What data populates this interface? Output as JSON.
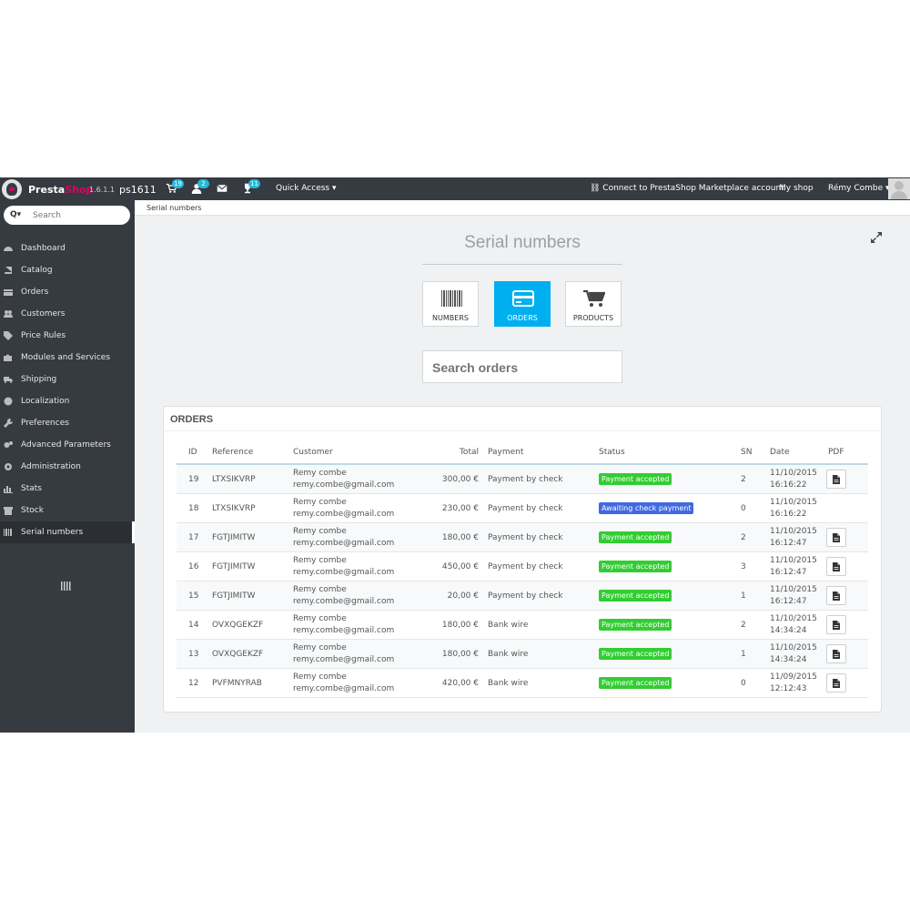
{
  "header": {
    "brand_part1": "Presta",
    "brand_part2": "Shop",
    "version": "1.6.1.1",
    "shop_name": "ps1611",
    "orders_count": "19",
    "customers_count": "2",
    "messages_icon": "envelope-icon",
    "trophy_count": "11",
    "quick_access_label": "Quick Access ▾",
    "marketplace_label": "Connect to PrestaShop Marketplace account",
    "my_shop_label": "My shop",
    "employee_label": "Rémy Combe ▾"
  },
  "sidebar": {
    "search_placeholder": "Search",
    "items": [
      {
        "label": "Dashboard",
        "icon": "dashboard-icon"
      },
      {
        "label": "Catalog",
        "icon": "book-icon"
      },
      {
        "label": "Orders",
        "icon": "credit-card-icon"
      },
      {
        "label": "Customers",
        "icon": "users-icon"
      },
      {
        "label": "Price Rules",
        "icon": "tags-icon"
      },
      {
        "label": "Modules and Services",
        "icon": "puzzle-icon"
      },
      {
        "label": "Shipping",
        "icon": "truck-icon"
      },
      {
        "label": "Localization",
        "icon": "globe-icon"
      },
      {
        "label": "Preferences",
        "icon": "wrench-icon"
      },
      {
        "label": "Advanced Parameters",
        "icon": "cogs-icon"
      },
      {
        "label": "Administration",
        "icon": "cog-icon"
      },
      {
        "label": "Stats",
        "icon": "bar-chart-icon"
      },
      {
        "label": "Stock",
        "icon": "archive-icon"
      },
      {
        "label": "Serial numbers",
        "icon": "barcode-icon"
      }
    ],
    "active_item": "Serial numbers"
  },
  "breadcrumb": "Serial numbers",
  "main": {
    "title": "Serial numbers",
    "modes": [
      {
        "label": "NUMBERS",
        "icon": "barcode-icon",
        "active": false
      },
      {
        "label": "ORDERS",
        "icon": "credit-card-icon",
        "active": true
      },
      {
        "label": "PRODUCTS",
        "icon": "cart-icon",
        "active": false
      }
    ],
    "search_placeholder": "Search orders"
  },
  "orders_panel": {
    "heading": "ORDERS",
    "columns": [
      "ID",
      "Reference",
      "Customer",
      "Total",
      "Payment",
      "Status",
      "SN",
      "Date",
      "PDF"
    ],
    "rows": [
      {
        "id": "19",
        "reference": "LTXSIKVRP",
        "customer_name": "Remy combe",
        "customer_email": "remy.combe@gmail.com",
        "total": "300,00 €",
        "payment": "Payment by check",
        "status": "Payment accepted",
        "status_color": "#32cd32",
        "sn": "2",
        "date": "11/10/2015",
        "time": "16:16:22",
        "has_pdf": true
      },
      {
        "id": "18",
        "reference": "LTXSIKVRP",
        "customer_name": "Remy combe",
        "customer_email": "remy.combe@gmail.com",
        "total": "230,00 €",
        "payment": "Payment by check",
        "status": "Awaiting check payment",
        "status_color": "#4169e1",
        "sn": "0",
        "date": "11/10/2015",
        "time": "16:16:22",
        "has_pdf": false
      },
      {
        "id": "17",
        "reference": "FGTJIMITW",
        "customer_name": "Remy combe",
        "customer_email": "remy.combe@gmail.com",
        "total": "180,00 €",
        "payment": "Payment by check",
        "status": "Payment accepted",
        "status_color": "#32cd32",
        "sn": "2",
        "date": "11/10/2015",
        "time": "16:12:47",
        "has_pdf": true
      },
      {
        "id": "16",
        "reference": "FGTJIMITW",
        "customer_name": "Remy combe",
        "customer_email": "remy.combe@gmail.com",
        "total": "450,00 €",
        "payment": "Payment by check",
        "status": "Payment accepted",
        "status_color": "#32cd32",
        "sn": "3",
        "date": "11/10/2015",
        "time": "16:12:47",
        "has_pdf": true
      },
      {
        "id": "15",
        "reference": "FGTJIMITW",
        "customer_name": "Remy combe",
        "customer_email": "remy.combe@gmail.com",
        "total": "20,00 €",
        "payment": "Payment by check",
        "status": "Payment accepted",
        "status_color": "#32cd32",
        "sn": "1",
        "date": "11/10/2015",
        "time": "16:12:47",
        "has_pdf": true
      },
      {
        "id": "14",
        "reference": "OVXQGEKZF",
        "customer_name": "Remy combe",
        "customer_email": "remy.combe@gmail.com",
        "total": "180,00 €",
        "payment": "Bank wire",
        "status": "Payment accepted",
        "status_color": "#32cd32",
        "sn": "2",
        "date": "11/10/2015",
        "time": "14:34:24",
        "has_pdf": true
      },
      {
        "id": "13",
        "reference": "OVXQGEKZF",
        "customer_name": "Remy combe",
        "customer_email": "remy.combe@gmail.com",
        "total": "180,00 €",
        "payment": "Bank wire",
        "status": "Payment accepted",
        "status_color": "#32cd32",
        "sn": "1",
        "date": "11/10/2015",
        "time": "14:34:24",
        "has_pdf": true
      },
      {
        "id": "12",
        "reference": "PVFMNYRAB",
        "customer_name": "Remy combe",
        "customer_email": "remy.combe@gmail.com",
        "total": "420,00 €",
        "payment": "Bank wire",
        "status": "Payment accepted",
        "status_color": "#32cd32",
        "sn": "0",
        "date": "11/09/2015",
        "time": "12:12:43",
        "has_pdf": true
      }
    ]
  },
  "colors": {
    "header_bg": "#363a41",
    "accent": "#00aff0",
    "brand_pink": "#df0067",
    "badge": "#25b9d7"
  }
}
